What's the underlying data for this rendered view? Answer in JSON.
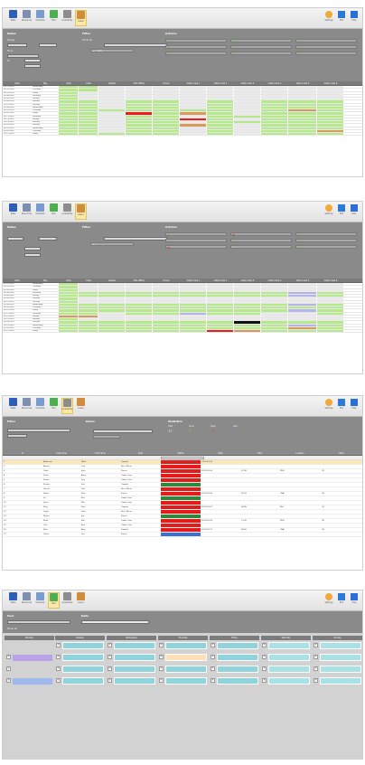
{
  "toolbar": {
    "left_buttons": [
      {
        "label": "Tasks",
        "icon": "person-icon",
        "color": "#2d5fb8"
      },
      {
        "label": "Resources",
        "icon": "grid-icon",
        "color": "#7e8fb2"
      },
      {
        "label": "Schedule",
        "icon": "calendar-icon",
        "color": "#7a9bd0"
      },
      {
        "label": "Plan",
        "icon": "arrow-icon",
        "color": "#4caf50"
      },
      {
        "label": "Availability",
        "icon": "clock-icon",
        "color": "#8d8d8d"
      },
      {
        "label": "Leave",
        "icon": "leave-icon",
        "color": "#d18c3a"
      }
    ],
    "right_buttons": [
      {
        "label": "Settings",
        "icon": "gear-icon",
        "color": "#f2a93b"
      },
      {
        "label": "Exit",
        "icon": "arrow-out-icon",
        "color": "#2d7ad6"
      },
      {
        "label": "Help",
        "icon": "help-icon",
        "color": "#2c6fd6"
      }
    ]
  },
  "panel1": {
    "dates_title": "Dates",
    "filter_title": "Filter",
    "actions_title": "Actions",
    "show_all_label": "Show all",
    "range_label": "Range",
    "from_label": "From",
    "to_label": "To",
    "apply": "Apply",
    "columns": [
      "Date",
      "Day",
      "Duty",
      "Crew",
      "Captain",
      "First Officer",
      "Purser",
      "Cabin Crew 1",
      "Cabin Crew 2",
      "Cabin Crew 3",
      "Cabin Crew 4",
      "Cabin Crew 5",
      "Cabin Crew 6"
    ],
    "rows": [
      [
        "01/01/2020",
        "Wednesday",
        "",
        "",
        "",
        "",
        "",
        "",
        "",
        "",
        "",
        "",
        ""
      ],
      [
        "01/02/2020",
        "Thursday",
        "",
        "",
        "",
        "",
        "",
        "",
        "",
        "",
        "",
        "",
        ""
      ],
      [
        "01/03/2020",
        "Friday",
        "",
        "",
        "",
        "",
        "",
        "",
        "",
        "",
        "",
        "",
        ""
      ],
      [
        "01/04/2020",
        "Saturday",
        "",
        "",
        "",
        "",
        "",
        "",
        "",
        "",
        "",
        "",
        ""
      ],
      [
        "01/05/2020",
        "Sunday",
        "",
        "",
        "",
        "",
        "",
        "",
        "",
        "",
        "",
        "",
        ""
      ],
      [
        "01/06/2020",
        "Monday",
        "",
        "",
        "",
        "",
        "",
        "",
        "",
        "",
        "",
        "",
        ""
      ],
      [
        "01/07/2020",
        "Tuesday",
        "",
        "",
        "",
        "",
        "",
        "",
        "",
        "",
        "",
        "",
        ""
      ],
      [
        "01/08/2020",
        "Wednesday",
        "",
        "",
        "",
        "",
        "",
        "",
        "",
        "",
        "",
        "",
        ""
      ],
      [
        "01/09/2020",
        "Thursday",
        "",
        "",
        "",
        "",
        "",
        "",
        "",
        "",
        "",
        "",
        ""
      ],
      [
        "01/10/2020",
        "Friday",
        "",
        "",
        "",
        "",
        "",
        "",
        "",
        "",
        "",
        "",
        ""
      ],
      [
        "01/11/2020",
        "Saturday",
        "",
        "",
        "",
        "",
        "",
        "",
        "",
        "",
        "",
        "",
        ""
      ],
      [
        "01/12/2020",
        "Sunday",
        "",
        "",
        "",
        "",
        "",
        "",
        "",
        "",
        "",
        "",
        ""
      ],
      [
        "01/13/2020",
        "Monday",
        "",
        "",
        "",
        "",
        "",
        "",
        "",
        "",
        "",
        "",
        ""
      ],
      [
        "01/14/2020",
        "Tuesday",
        "",
        "",
        "",
        "",
        "",
        "",
        "",
        "",
        "",
        "",
        ""
      ],
      [
        "01/15/2020",
        "Wednesday",
        "",
        "",
        "",
        "",
        "",
        "",
        "",
        "",
        "",
        "",
        ""
      ],
      [
        "01/16/2020",
        "Thursday",
        "",
        "",
        "",
        "",
        "",
        "",
        "",
        "",
        "",
        "",
        ""
      ],
      [
        "01/17/2020",
        "Friday",
        "",
        "",
        "",
        "",
        "",
        "",
        "",
        "",
        "",
        "",
        ""
      ]
    ]
  },
  "panel2": {
    "dates_title": "Dates",
    "filter_title": "Filter",
    "actions_title": "Actions"
  },
  "panel3": {
    "filter_title": "Filter",
    "dates_title": "Dates",
    "statistics_title": "Statistics",
    "stats": [
      {
        "label": "Total",
        "value": "17"
      },
      {
        "label": "Done",
        "value": "5"
      },
      {
        "label": "Open",
        "value": "11"
      },
      {
        "label": "Late",
        "value": "1"
      }
    ],
    "columns": [
      "#",
      "Last name",
      "First name",
      "Role",
      "Status",
      "Date",
      "Time",
      "Location",
      "Note"
    ],
    "rows": [
      {
        "num": "1",
        "last": "Anderson",
        "first": "Mark",
        "role": "Captain",
        "status": "red",
        "date": "2020-01-02",
        "time": "",
        "loc": "",
        "note": ""
      },
      {
        "num": "2",
        "last": "Brown",
        "first": "Lisa",
        "role": "First Officer",
        "status": "red",
        "date": "",
        "time": "",
        "loc": "",
        "note": ""
      },
      {
        "num": "3",
        "last": "Clark",
        "first": "John",
        "role": "Purser",
        "status": "red",
        "date": "2020-01-03",
        "time": "07:30",
        "loc": "ZRH",
        "note": "OK"
      },
      {
        "num": "4",
        "last": "Davis",
        "first": "Anna",
        "role": "Cabin Crew",
        "status": "red",
        "date": "",
        "time": "",
        "loc": "",
        "note": ""
      },
      {
        "num": "5",
        "last": "Evans",
        "first": "Tom",
        "role": "Cabin Crew",
        "status": "red",
        "date": "",
        "time": "",
        "loc": "",
        "note": ""
      },
      {
        "num": "6",
        "last": "Fischer",
        "first": "Eva",
        "role": "Captain",
        "status": "green",
        "date": "",
        "time": "",
        "loc": "",
        "note": ""
      },
      {
        "num": "7",
        "last": "Garcia",
        "first": "Luis",
        "role": "First Officer",
        "status": "red",
        "date": "",
        "time": "",
        "loc": "",
        "note": ""
      },
      {
        "num": "8",
        "last": "Harris",
        "first": "Kate",
        "role": "Purser",
        "status": "red",
        "date": "2020-01-05",
        "time": "09:15",
        "loc": "GVA",
        "note": "OK"
      },
      {
        "num": "9",
        "last": "Ito",
        "first": "Ken",
        "role": "Cabin Crew",
        "status": "green",
        "date": "",
        "time": "",
        "loc": "",
        "note": ""
      },
      {
        "num": "10",
        "last": "Jones",
        "first": "Mia",
        "role": "Cabin Crew",
        "status": "red",
        "date": "",
        "time": "",
        "loc": "",
        "note": ""
      },
      {
        "num": "11",
        "last": "King",
        "first": "Paul",
        "role": "Captain",
        "status": "red",
        "date": "2020-01-07",
        "time": "06:45",
        "loc": "BSL",
        "note": "OK"
      },
      {
        "num": "12",
        "last": "Lopez",
        "first": "Sara",
        "role": "First Officer",
        "status": "red",
        "date": "",
        "time": "",
        "loc": "",
        "note": ""
      },
      {
        "num": "13",
        "last": "Meyer",
        "first": "Jan",
        "role": "Purser",
        "status": "green",
        "date": "",
        "time": "",
        "loc": "",
        "note": ""
      },
      {
        "num": "14",
        "last": "Nash",
        "first": "Ella",
        "role": "Cabin Crew",
        "status": "red",
        "date": "2020-01-09",
        "time": "11:00",
        "loc": "ZRH",
        "note": "OK"
      },
      {
        "num": "15",
        "last": "Otto",
        "first": "Ben",
        "role": "Cabin Crew",
        "status": "red",
        "date": "",
        "time": "",
        "loc": "",
        "note": ""
      },
      {
        "num": "16",
        "last": "Park",
        "first": "Amy",
        "role": "Captain",
        "status": "red",
        "date": "2020-01-11",
        "time": "08:20",
        "loc": "GVA",
        "note": "OK"
      },
      {
        "num": "17",
        "last": "Quinn",
        "first": "Leo",
        "role": "Purser",
        "status": "blue",
        "date": "",
        "time": "",
        "loc": "",
        "note": ""
      }
    ]
  },
  "panel4": {
    "user_title": "User",
    "date_title": "Date",
    "show_label": "Show all",
    "days": [
      "Monday",
      "Tuesday",
      "Wednesday",
      "Thursday",
      "Friday",
      "Saturday",
      "Sunday"
    ]
  }
}
